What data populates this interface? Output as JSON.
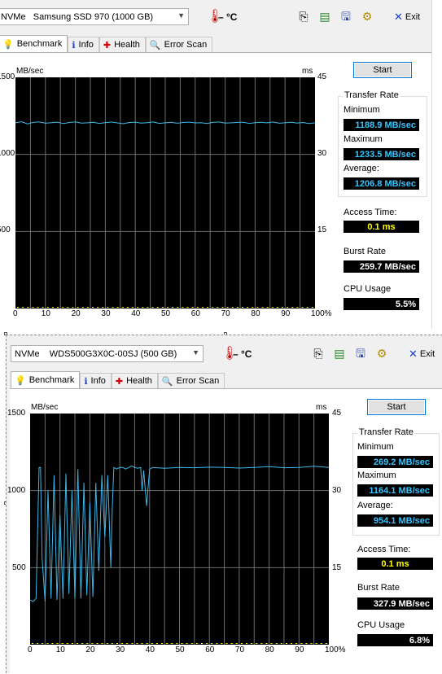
{
  "colors": {
    "curve": "#3fb6e8",
    "chart_bg": "#000000",
    "grid": "#6e6e6e",
    "access_mark": "#ffff00"
  },
  "icons": {
    "thermometer": "thermometer-icon",
    "copy": "copy-icon",
    "copy2": "copy-text-icon",
    "save": "save-icon",
    "options": "options-icon",
    "exit": "exit-icon"
  },
  "panels": [
    {
      "drive": "NVMe   Samsung SSD 970 (1000 GB)",
      "temperature": "– °C",
      "exit_label": "Exit",
      "tabs": [
        {
          "label": "Benchmark",
          "icon": "benchmark-icon"
        },
        {
          "label": "Info",
          "icon": "info-icon"
        },
        {
          "label": "Health",
          "icon": "health-icon"
        },
        {
          "label": "Error Scan",
          "icon": "error-scan-icon"
        }
      ],
      "start_label": "Start",
      "unit_left": "MB/sec",
      "unit_right": "ms",
      "y_ticks_left": [
        "1500",
        "1000",
        "500"
      ],
      "y_ticks_right": [
        "45",
        "30",
        "15"
      ],
      "x_ticks": [
        "0",
        "10",
        "20",
        "30",
        "40",
        "50",
        "60",
        "70",
        "80",
        "90",
        "100%"
      ],
      "transfer_rate_title": "Transfer Rate",
      "minimum_label": "Minimum",
      "minimum_value": "1188.9 MB/sec",
      "maximum_label": "Maximum",
      "maximum_value": "1233.5 MB/sec",
      "average_label": "Average:",
      "average_value": "1206.8 MB/sec",
      "access_label": "Access Time:",
      "access_value": "0.1 ms",
      "burst_label": "Burst Rate",
      "burst_value": "259.7 MB/sec",
      "cpu_label": "CPU Usage",
      "cpu_value": "5.5%"
    },
    {
      "drive": "NVMe    WDS500G3X0C-00SJ (500 GB)",
      "temperature": "– °C",
      "exit_label": "Exit",
      "tabs": [
        {
          "label": "Benchmark",
          "icon": "benchmark-icon"
        },
        {
          "label": "Info",
          "icon": "info-icon"
        },
        {
          "label": "Health",
          "icon": "health-icon"
        },
        {
          "label": "Error Scan",
          "icon": "error-scan-icon"
        }
      ],
      "start_label": "Start",
      "unit_left": "MB/sec",
      "unit_right": "ms",
      "y_ticks_left": [
        "1500",
        "1000",
        "500"
      ],
      "y_ticks_right": [
        "45",
        "30",
        "15"
      ],
      "x_ticks": [
        "0",
        "10",
        "20",
        "30",
        "40",
        "50",
        "60",
        "70",
        "80",
        "90",
        "100%"
      ],
      "transfer_rate_title": "Transfer Rate",
      "minimum_label": "Minimum",
      "minimum_value": "269.2 MB/sec",
      "maximum_label": "Maximum",
      "maximum_value": "1164.1 MB/sec",
      "average_label": "Average:",
      "average_value": "954.1 MB/sec",
      "access_label": "Access Time:",
      "access_value": "0.1 ms",
      "burst_label": "Burst Rate",
      "burst_value": "327.9 MB/sec",
      "cpu_label": "CPU Usage",
      "cpu_value": "6.8%"
    }
  ],
  "chart_data": [
    {
      "type": "line",
      "xlabel": "",
      "ylabel": "MB/sec",
      "xlim": [
        0,
        100
      ],
      "ylim": [
        0,
        1500
      ],
      "y2lim": [
        0,
        45
      ],
      "series": [
        {
          "x": [
            0,
            2,
            4,
            6,
            8,
            10,
            12,
            14,
            16,
            18,
            20,
            22,
            24,
            26,
            28,
            30,
            32,
            34,
            36,
            38,
            40,
            42,
            44,
            46,
            48,
            50,
            52,
            54,
            56,
            58,
            60,
            62,
            64,
            66,
            68,
            70,
            72,
            74,
            76,
            78,
            80,
            82,
            84,
            86,
            88,
            90,
            92,
            94,
            96,
            98,
            100
          ],
          "values": [
            1205,
            1212,
            1198,
            1208,
            1210,
            1202,
            1206,
            1209,
            1200,
            1207,
            1211,
            1203,
            1205,
            1208,
            1201,
            1206,
            1210,
            1204,
            1199,
            1207,
            1209,
            1203,
            1206,
            1210,
            1201,
            1205,
            1208,
            1202,
            1207,
            1209,
            1204,
            1206,
            1200,
            1208,
            1210,
            1203,
            1205,
            1207,
            1209,
            1201,
            1206,
            1208,
            1204,
            1210,
            1202,
            1205,
            1209,
            1203,
            1207,
            1200,
            1205
          ]
        }
      ]
    },
    {
      "type": "line",
      "xlabel": "",
      "ylabel": "MB/sec",
      "xlim": [
        0,
        100
      ],
      "ylim": [
        0,
        1500
      ],
      "y2lim": [
        0,
        45
      ],
      "series": [
        {
          "x": [
            0,
            1,
            2,
            3,
            3.5,
            4,
            5,
            6,
            7,
            8,
            9,
            10,
            11,
            12,
            13,
            14,
            15,
            16,
            17,
            18,
            19,
            20,
            21,
            22,
            23,
            24,
            25,
            26,
            27,
            27.5,
            28,
            29,
            30,
            31,
            32,
            33,
            34,
            35,
            36,
            37,
            37.5,
            38,
            39,
            40,
            41,
            45,
            50,
            55,
            60,
            65,
            70,
            75,
            80,
            85,
            90,
            95,
            100
          ],
          "values": [
            290,
            280,
            300,
            1150,
            1150,
            560,
            280,
            1000,
            300,
            1100,
            290,
            840,
            300,
            1110,
            330,
            1000,
            300,
            1140,
            300,
            1050,
            320,
            920,
            310,
            1050,
            480,
            1100,
            700,
            1100,
            500,
            880,
            1150,
            1140,
            1150,
            1150,
            1140,
            1150,
            1160,
            1150,
            1145,
            1150,
            1000,
            1130,
            900,
            1140,
            1150,
            1145,
            1150,
            1148,
            1152,
            1150,
            1146,
            1150,
            1155,
            1148,
            1150,
            1158,
            1150
          ]
        }
      ]
    }
  ]
}
